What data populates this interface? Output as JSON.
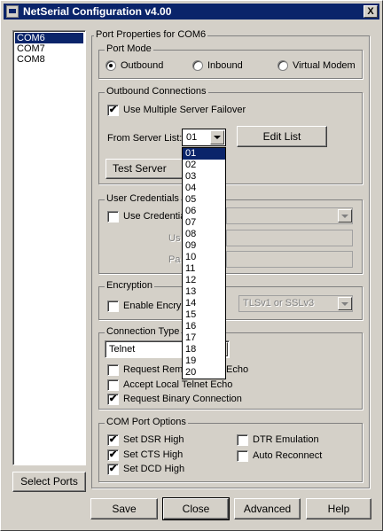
{
  "window": {
    "title": "NetSerial Configuration v4.00",
    "close_label": "X"
  },
  "ports": {
    "items": [
      "COM6",
      "COM7",
      "COM8"
    ],
    "selected": "COM6",
    "select_button": "Select Ports"
  },
  "properties": {
    "title": "Port Properties for COM6"
  },
  "port_mode": {
    "title": "Port  Mode",
    "options": [
      "Outbound",
      "Inbound",
      "Virtual Modem"
    ],
    "selected": "Outbound"
  },
  "outbound": {
    "title": "Outbound Connections",
    "failover_label": "Use Multiple Server Failover",
    "failover_checked": true,
    "server_list_label": "From Server List:",
    "server_list_value": "01",
    "edit_list_button": "Edit List",
    "test_button": "Test Server Conn",
    "server_list_options": [
      "01",
      "02",
      "03",
      "04",
      "05",
      "06",
      "07",
      "08",
      "09",
      "10",
      "11",
      "12",
      "13",
      "14",
      "15",
      "16",
      "17",
      "18",
      "19",
      "20"
    ]
  },
  "credentials": {
    "title": "User Credentials",
    "use_label": "Use Credentia",
    "user_label": "Us",
    "pass_label": "Pa",
    "use_checked": false
  },
  "encryption": {
    "title": "Encryption",
    "enable_label": "Enable Encryp",
    "protocol": "TLSv1 or SSLv3",
    "enabled": false
  },
  "connection": {
    "title": "Connection Type",
    "value": "Telnet",
    "options": [
      {
        "label": "Request Rem",
        "suffix": "Echo",
        "checked": false
      },
      {
        "label": "Accept Local Telnet Echo",
        "checked": false
      },
      {
        "label": "Request Binary Connection",
        "checked": true
      }
    ]
  },
  "com_options": {
    "title": "COM Port Options",
    "left": [
      {
        "label": "Set DSR High",
        "checked": true
      },
      {
        "label": "Set CTS High",
        "checked": true
      },
      {
        "label": "Set DCD High",
        "checked": true
      }
    ],
    "right": [
      {
        "label": "DTR Emulation",
        "checked": false
      },
      {
        "label": "Auto Reconnect",
        "checked": false
      }
    ]
  },
  "footer": {
    "save": "Save",
    "close": "Close",
    "advanced": "Advanced",
    "help": "Help"
  },
  "check_mark": "✔"
}
